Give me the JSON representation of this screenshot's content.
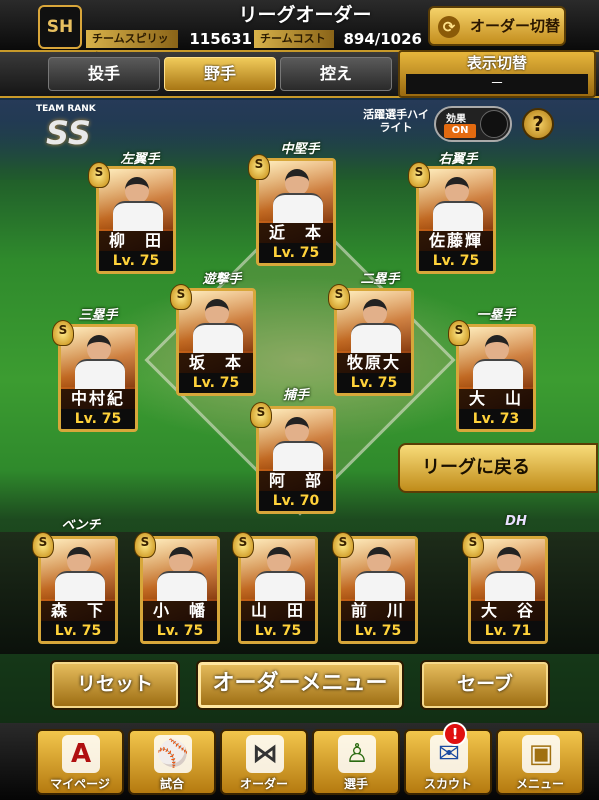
{
  "header": {
    "logo": "SH",
    "title": "リーグオーダー",
    "spirits_label": "チームスピリッツ",
    "spirits_value": "115631",
    "cost_label": "チームコスト",
    "cost_value": "894/1026",
    "swap_button": "オーダー切替",
    "swap_icon": "cycle-icon"
  },
  "tabs": [
    {
      "label": "投手",
      "active": false
    },
    {
      "label": "野手",
      "active": true
    },
    {
      "label": "控え",
      "active": false
    }
  ],
  "display_toggle": {
    "title": "表示切替",
    "value": "－"
  },
  "team_rank": {
    "label": "TEAM RANK",
    "value": "SS"
  },
  "highlight": {
    "label": "活躍選手ハイライト",
    "toggle_top": "効果",
    "toggle_state": "ON",
    "help": "?"
  },
  "positions": {
    "lf": "左翼手",
    "cf": "中堅手",
    "rf": "右翼手",
    "ss": "遊撃手",
    "b2": "二塁手",
    "b3": "三塁手",
    "b1": "一塁手",
    "c": "捕手",
    "bench": "ベンチ",
    "dh": "DH"
  },
  "players": {
    "lf": {
      "name": "柳　田",
      "level": "Lv. 75",
      "badge": "S"
    },
    "cf": {
      "name": "近　本",
      "level": "Lv. 75",
      "badge": "S"
    },
    "rf": {
      "name": "佐藤輝",
      "level": "Lv. 75",
      "badge": "S"
    },
    "ss": {
      "name": "坂　本",
      "level": "Lv. 75",
      "badge": "S"
    },
    "b2": {
      "name": "牧原大",
      "level": "Lv. 75",
      "badge": "S"
    },
    "b3": {
      "name": "中村紀",
      "level": "Lv. 75",
      "badge": "S"
    },
    "b1": {
      "name": "大　山",
      "level": "Lv. 73",
      "badge": "S"
    },
    "c": {
      "name": "阿　部",
      "level": "Lv. 70",
      "badge": "S"
    },
    "bench1": {
      "name": "森　下",
      "level": "Lv. 75",
      "badge": "S"
    },
    "bench2": {
      "name": "小　幡",
      "level": "Lv. 75",
      "badge": "S"
    },
    "bench3": {
      "name": "山　田",
      "level": "Lv. 75",
      "badge": "S"
    },
    "bench4": {
      "name": "前　川",
      "level": "Lv. 75",
      "badge": "S"
    },
    "dh": {
      "name": "大　谷",
      "level": "Lv. 71",
      "badge": "S"
    }
  },
  "return_button": "リーグに戻る",
  "actions": {
    "reset": "リセット",
    "order_menu": "オーダーメニュー",
    "save": "セーブ"
  },
  "nav": [
    {
      "label": "マイページ",
      "icon": "A"
    },
    {
      "label": "試合",
      "icon": "⚾"
    },
    {
      "label": "オーダー",
      "icon": "⋈"
    },
    {
      "label": "選手",
      "icon": "♙"
    },
    {
      "label": "スカウト",
      "icon": "✉"
    },
    {
      "label": "メニュー",
      "icon": "▣"
    }
  ],
  "notification": "!"
}
